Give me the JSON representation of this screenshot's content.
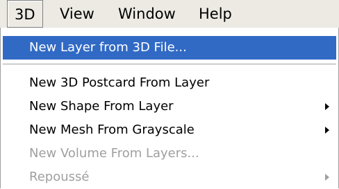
{
  "menubar": {
    "items": [
      "3D",
      "View",
      "Window",
      "Help"
    ],
    "active_index": 0
  },
  "menu": {
    "items": [
      {
        "label": "New Layer from 3D File...",
        "state": "highlighted",
        "submenu": false
      },
      {
        "label": "New 3D Postcard From Layer",
        "state": "normal",
        "submenu": false
      },
      {
        "label": "New Shape From Layer",
        "state": "normal",
        "submenu": true
      },
      {
        "label": "New Mesh From Grayscale",
        "state": "normal",
        "submenu": true
      },
      {
        "label": "New Volume From Layers...",
        "state": "disabled",
        "submenu": false
      },
      {
        "label": "Repoussé",
        "state": "disabled",
        "submenu": true
      }
    ]
  },
  "colors": {
    "menubar_bg": "#eceae3",
    "highlight": "#316ac5",
    "disabled_text": "#9f9f9f"
  }
}
